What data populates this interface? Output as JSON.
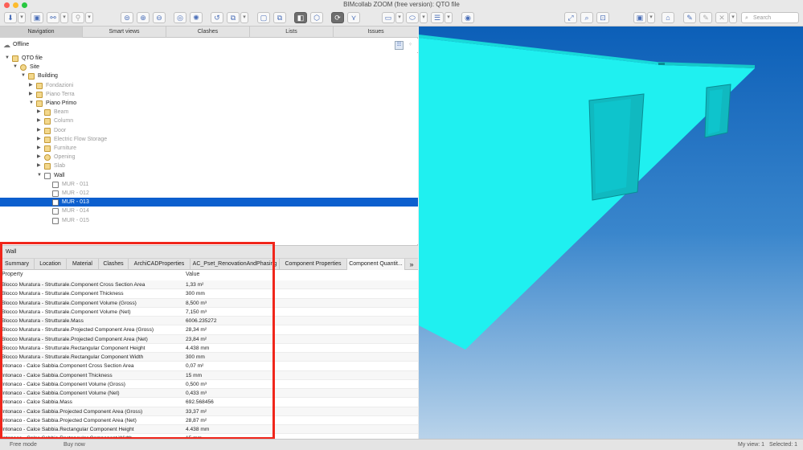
{
  "window": {
    "title": "BIMcollab ZOOM (free version): QTO file"
  },
  "toolbar": {
    "search_placeholder": "Search"
  },
  "nav_tabs": [
    "Navigation",
    "Smart views",
    "Clashes",
    "Lists",
    "Issues"
  ],
  "connection_status": "Offline",
  "tree": [
    {
      "label": "QTO file",
      "icon": "folder",
      "expanded": true,
      "dim": false
    },
    {
      "label": "Site",
      "icon": "site",
      "expanded": true,
      "dim": false
    },
    {
      "label": "Building",
      "icon": "building",
      "expanded": true,
      "dim": false
    },
    {
      "label": "Fondazioni",
      "icon": "storey",
      "expanded": false,
      "dim": true
    },
    {
      "label": "Piano Terra",
      "icon": "storey",
      "expanded": false,
      "dim": true
    },
    {
      "label": "Piano Primo",
      "icon": "storey",
      "expanded": true,
      "dim": false
    },
    {
      "label": "Beam",
      "icon": "beam",
      "expanded": false,
      "dim": true
    },
    {
      "label": "Column",
      "icon": "column",
      "expanded": false,
      "dim": true
    },
    {
      "label": "Door",
      "icon": "door",
      "expanded": false,
      "dim": true
    },
    {
      "label": "Electric Flow Storage",
      "icon": "folder",
      "expanded": false,
      "dim": true
    },
    {
      "label": "Furniture",
      "icon": "folder",
      "expanded": false,
      "dim": true
    },
    {
      "label": "Opening",
      "icon": "opening",
      "expanded": false,
      "dim": true
    },
    {
      "label": "Slab",
      "icon": "folder",
      "expanded": false,
      "dim": true
    },
    {
      "label": "Wall",
      "icon": "wall",
      "expanded": true,
      "dim": false
    },
    {
      "label": "MUR - 011",
      "icon": "wall",
      "expanded": null,
      "dim": true
    },
    {
      "label": "MUR - 012",
      "icon": "wall",
      "expanded": null,
      "dim": true
    },
    {
      "label": "MUR - 013",
      "icon": "wall",
      "expanded": null,
      "dim": false,
      "selected": true
    },
    {
      "label": "MUR - 014",
      "icon": "wall",
      "expanded": null,
      "dim": true
    },
    {
      "label": "MUR - 015",
      "icon": "wall",
      "expanded": null,
      "dim": true
    }
  ],
  "selection_title": "Wall",
  "prop_tabs": [
    "Summary",
    "Location",
    "Material",
    "Clashes",
    "ArchiCADProperties",
    "AC_Pset_RenovationAndPhasing",
    "Component Properties",
    "Component Quantit..."
  ],
  "table": {
    "headers": [
      "Property",
      "Value"
    ],
    "rows": [
      [
        "Blocco Muratura - Strutturale.Component Cross Section Area",
        "1,33 m²"
      ],
      [
        "Blocco Muratura - Strutturale.Component Thickness",
        "300 mm"
      ],
      [
        "Blocco Muratura - Strutturale.Component Volume (Gross)",
        "8,500 m³"
      ],
      [
        "Blocco Muratura - Strutturale.Component Volume (Net)",
        "7,150 m³"
      ],
      [
        "Blocco Muratura - Strutturale.Mass",
        "6006.235272"
      ],
      [
        "Blocco Muratura - Strutturale.Projected Component Area (Gross)",
        "28,34 m²"
      ],
      [
        "Blocco Muratura - Strutturale.Projected Component Area (Net)",
        "23,84 m²"
      ],
      [
        "Blocco Muratura - Strutturale.Rectangular Component Height",
        "4.438 mm"
      ],
      [
        "Blocco Muratura - Strutturale.Rectangular Component Width",
        "300 mm"
      ],
      [
        "Intonaco - Calce Sabbia.Component Cross Section Area",
        "0,07 m²"
      ],
      [
        "Intonaco - Calce Sabbia.Component Thickness",
        "15 mm"
      ],
      [
        "Intonaco - Calce Sabbia.Component Volume (Gross)",
        "0,500 m³"
      ],
      [
        "Intonaco - Calce Sabbia.Component Volume (Net)",
        "0,433 m³"
      ],
      [
        "Intonaco - Calce Sabbia.Mass",
        "692.568456"
      ],
      [
        "Intonaco - Calce Sabbia.Projected Component Area (Gross)",
        "33,37 m²"
      ],
      [
        "Intonaco - Calce Sabbia.Projected Component Area (Net)",
        "28,87 m²"
      ],
      [
        "Intonaco - Calce Sabbia.Rectangular Component Height",
        "4.438 mm"
      ],
      [
        "Intonaco - Calce Sabbia.Rectangular Component Width",
        "15 mm"
      ],
      [
        "Intonaco - Gesso.Component Cross Section Area",
        "0,07 m²"
      ],
      [
        "Intonaco - Gesso.Component Thickness",
        "15 mm"
      ]
    ]
  },
  "statusbar": {
    "mode": "Free mode",
    "buy": "Buy now",
    "view": "My view: 1",
    "selected": "Selected: 1"
  },
  "colors": {
    "selection": "#0c5fce",
    "highlight_box": "#f0261b",
    "model": "#1ff0f0",
    "viewport_top": "#0c5fb8"
  }
}
